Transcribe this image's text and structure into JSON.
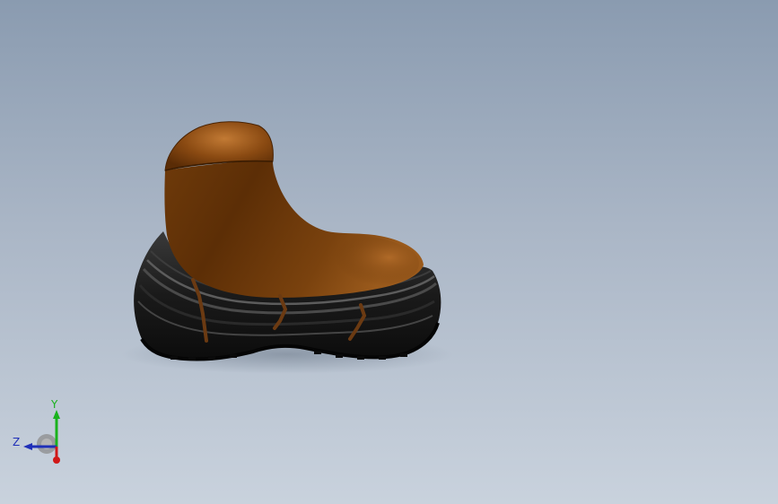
{
  "viewport": {
    "model": "boot-part"
  },
  "triad": {
    "y_label": "Y",
    "z_label": "Z",
    "colors": {
      "x": "#d01818",
      "y": "#19b21c",
      "z": "#1f2fb8"
    }
  },
  "colors": {
    "leather_dark": "#5a2d06",
    "leather_mid": "#8a4a10",
    "leather_light": "#b8742e",
    "sole_dark": "#141414",
    "sole_mid": "#2e2e2e",
    "sole_light": "#5a5a5a",
    "welt": "#6b3a12"
  }
}
